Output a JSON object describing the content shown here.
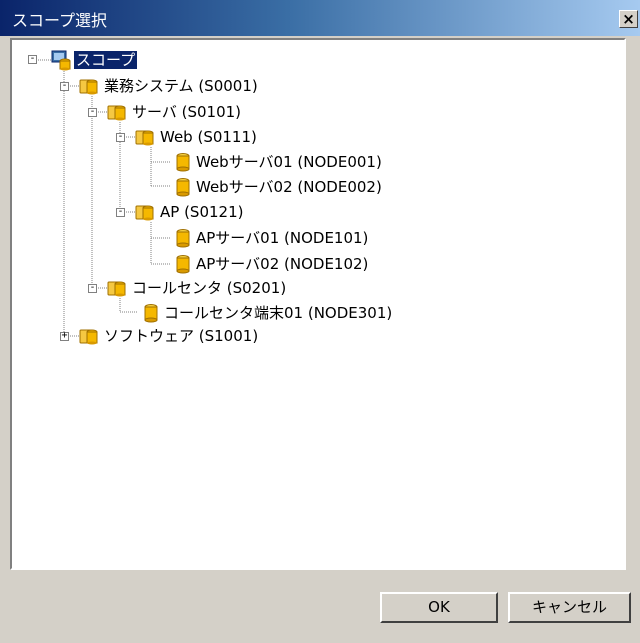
{
  "window": {
    "title": "スコープ選択",
    "close_glyph": "×"
  },
  "tree": {
    "root": {
      "label": "スコープ",
      "icon": "scope-root-icon",
      "expanded": true,
      "selected": true
    },
    "nodes": [
      {
        "label": "業務システム (S0001)",
        "icon": "folder-db-icon",
        "expanded": true
      },
      {
        "label": "サーバ (S0101)",
        "icon": "folder-db-icon",
        "expanded": true
      },
      {
        "label": "Web (S0111)",
        "icon": "folder-db-icon",
        "expanded": true
      },
      {
        "label": "Webサーバ01 (NODE001)",
        "icon": "database-icon"
      },
      {
        "label": "Webサーバ02 (NODE002)",
        "icon": "database-icon"
      },
      {
        "label": "AP (S0121)",
        "icon": "folder-db-icon",
        "expanded": true
      },
      {
        "label": "APサーバ01 (NODE101)",
        "icon": "database-icon"
      },
      {
        "label": "APサーバ02 (NODE102)",
        "icon": "database-icon"
      },
      {
        "label": "コールセンタ (S0201)",
        "icon": "folder-db-icon",
        "expanded": true
      },
      {
        "label": "コールセンタ端末01 (NODE301)",
        "icon": "database-icon"
      },
      {
        "label": "ソフトウェア (S1001)",
        "icon": "folder-db-icon",
        "expanded": false
      }
    ]
  },
  "buttons": {
    "ok": "OK",
    "cancel": "キャンセル"
  },
  "colors": {
    "selection": "#0a246a",
    "folder": "#f5b800",
    "dialog_bg": "#d4d0c8"
  }
}
